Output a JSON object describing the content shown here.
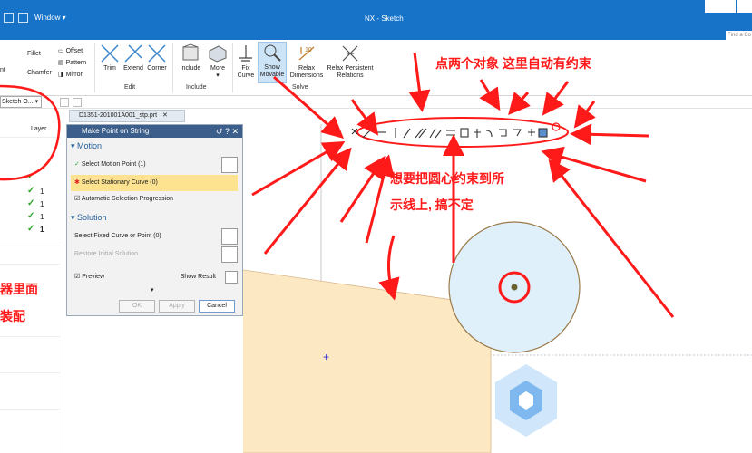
{
  "window": {
    "title": "NX - Sketch",
    "menu_window": "Window",
    "search_placeholder": "Find a Co"
  },
  "ribbon": {
    "sketch_tools_left": [
      "Fillet",
      "nt",
      "Chamfer"
    ],
    "pattern_tools": [
      "Offset",
      "Pattern",
      "Mirror"
    ],
    "edit_items": [
      {
        "label": "Trim",
        "icon": "trim-icon"
      },
      {
        "label": "Extend",
        "icon": "extend-icon"
      },
      {
        "label": "Corner",
        "icon": "corner-icon"
      }
    ],
    "edit_group": "Edit",
    "include_items": [
      {
        "label": "Include",
        "icon": "include-icon"
      },
      {
        "label": "More",
        "icon": "more-icon"
      }
    ],
    "include_group": "Include",
    "solve_items": [
      {
        "label": "Fix Curve",
        "icon": "fix-curve-icon"
      },
      {
        "label": "Show Movable",
        "icon": "show-movable-icon"
      },
      {
        "label": "Relax Dimensions",
        "icon": "relax-dimensions-icon"
      },
      {
        "label": "Relax Persistent Relations",
        "icon": "relax-relations-icon"
      }
    ],
    "solve_group": "Solve"
  },
  "toolbar2": {
    "sketch_select": "Sketch O..."
  },
  "navigator": {
    "header": "Layer",
    "rows": [
      {
        "check": "✓",
        "num": ""
      },
      {
        "check": "✓",
        "num": "1"
      },
      {
        "check": "✓",
        "num": "1"
      },
      {
        "check": "✓",
        "num": "1"
      },
      {
        "check": "✓",
        "num": "1"
      }
    ]
  },
  "tab": {
    "label": "D1351-201001A001_stp.prt"
  },
  "dialog": {
    "title": "Make Point on String",
    "motion_section": "Motion",
    "select_motion_point": "Select Motion Point (1)",
    "select_stationary_curve": "Select Stationary Curve (0)",
    "auto_selection": "Automatic Selection Progression",
    "solution_section": "Solution",
    "select_fixed": "Select Fixed Curve or Point (0)",
    "restore_solution": "Restore Initial Solution",
    "preview": "Preview",
    "show_result": "Show Result",
    "ok": "OK",
    "apply": "Apply",
    "cancel": "Cancel"
  },
  "annotations": {
    "top_note": "点两个对象  这里自动有约束",
    "mid_note_line1": "想要把圆心约束到所",
    "mid_note_line2": "示线上, 搞不定",
    "left_note_line1": "器里面",
    "left_note_line2": "装配"
  },
  "colors": {
    "title_bar": "#1773c7",
    "annotation_red": "#ff1a1a",
    "sheet_fill": "#fde8c4",
    "circle_fill": "#dff0fb",
    "circle_stroke": "#9a7a49"
  }
}
